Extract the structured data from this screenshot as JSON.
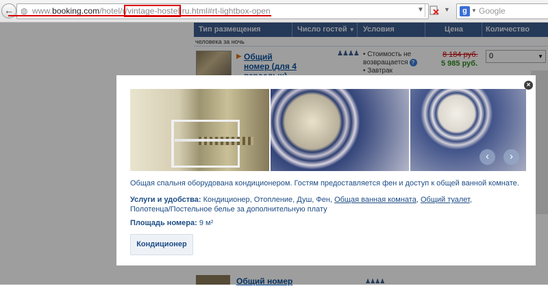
{
  "browser": {
    "url_host_prefix": "www.",
    "url_host": "booking.com",
    "url_path_a": "/hotel/",
    "url_path_b": "r",
    "url_highlighted": "/vintage-hostel",
    "url_suffix": ".ru.html#rt-lightbox-open",
    "search_placeholder": "Google",
    "back_glyph": "←",
    "reload_glyph": "↻",
    "dropdown_glyph": "▼"
  },
  "table": {
    "headers": [
      "Тип размещения",
      "Число гостей",
      "Условия",
      "Цена",
      "Количество"
    ],
    "guests_sort_glyph": "▼",
    "sub_header_text": "человека за ночь",
    "row1": {
      "room_name": "Общий номер (для 4 взрослых)",
      "conditions": [
        "• Стоимость не возвращается",
        "• Завтрак"
      ],
      "help": "?",
      "old_price": "8 184 руб.",
      "new_price": "5 985 руб.",
      "qty": "0"
    },
    "bottom_room_name": "Общий номер",
    "guests_icon": "♟♟♟♟"
  },
  "modal": {
    "close_glyph": "×",
    "prev_glyph": "‹",
    "next_glyph": "›",
    "description": "Общая спальня оборудована кондиционером. Гостям предоставляется фен и доступ к общей ванной комнате.",
    "amenities_label": "Услуги и удобства:",
    "amenities_plain": " Кондиционер, Отопление, Душ, Фен, ",
    "amenity_link_1": "Общая ванная комната",
    "amenities_sep": ", ",
    "amenity_link_2": "Общий туалет",
    "amenities_tail": ",",
    "amenities_line2": "Полотенца/Постельное белье за дополнительную плату",
    "area_label": "Площадь номера:",
    "area_value": " 9 м²",
    "ac_button": "Кондиционер"
  },
  "colors": {
    "header": "#3d5d8f",
    "link": "#0b4f9c",
    "price_old": "#cc0000",
    "price_new": "#2e8b1e",
    "annotation_red": "#d80000"
  }
}
